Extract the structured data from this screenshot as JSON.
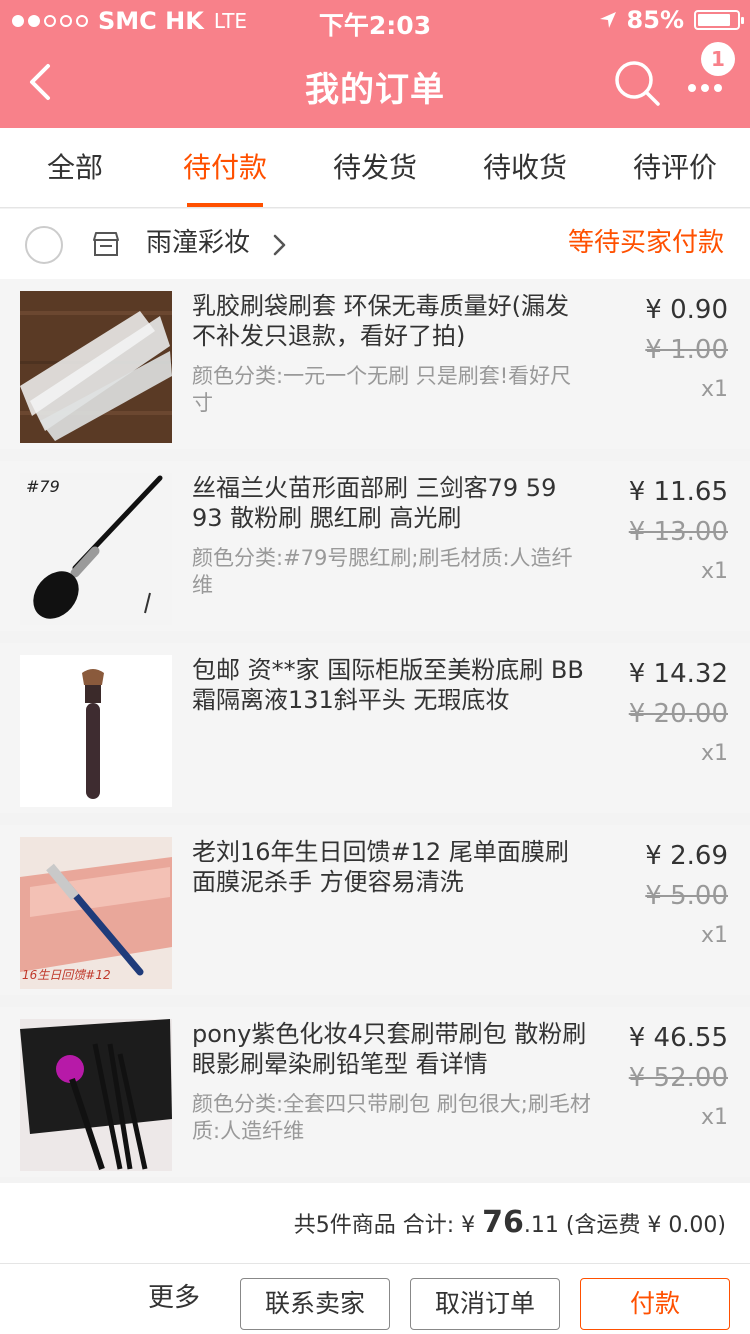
{
  "status_bar": {
    "carrier": "SMC HK",
    "network": "LTE",
    "time": "下午2:03",
    "battery": "85%",
    "battery_level": 0.85
  },
  "nav": {
    "title": "我的订单",
    "badge": "1"
  },
  "tabs": [
    {
      "label": "全部",
      "active": false
    },
    {
      "label": "待付款",
      "active": true
    },
    {
      "label": "待发货",
      "active": false
    },
    {
      "label": "待收货",
      "active": false
    },
    {
      "label": "待评价",
      "active": false
    }
  ],
  "shop": {
    "name": "雨潼彩妆",
    "status": "等待买家付款"
  },
  "items": [
    {
      "name": "乳胶刷袋刷套 环保无毒质量好(漏发不补发只退款，看好了拍)",
      "sku": "颜色分类:一元一个无刷 只是刷套!看好尺寸",
      "price": "¥ 0.90",
      "original_price": "¥ 1.00",
      "qty": "x1"
    },
    {
      "name": "丝福兰火苗形面部刷 三剑客79 59 93 散粉刷 腮红刷 高光刷",
      "sku": "颜色分类:#79号腮红刷;刷毛材质:人造纤维",
      "price": "¥ 11.65",
      "original_price": "¥ 13.00",
      "qty": "x1",
      "photo_label": "#79"
    },
    {
      "name": "包邮 资**家 国际柜版至美粉底刷 BB霜隔离液131斜平头 无瑕底妆",
      "sku": "",
      "price": "¥ 14.32",
      "original_price": "¥ 20.00",
      "qty": "x1"
    },
    {
      "name": "老刘16年生日回馈#12 尾单面膜刷 面膜泥杀手 方便容易清洗",
      "sku": "",
      "price": "¥ 2.69",
      "original_price": "¥ 5.00",
      "qty": "x1",
      "photo_label": "16生日回馈#12"
    },
    {
      "name": "pony紫色化妆4只套刷带刷包  散粉刷眼影刷晕染刷铅笔型 看详情",
      "sku": "颜色分类:全套四只带刷包 刷包很大;刷毛材质:人造纤维",
      "price": "¥ 46.55",
      "original_price": "¥ 52.00",
      "qty": "x1"
    }
  ],
  "summary": {
    "count_text": "共5件商品 合计:",
    "currency": "¥",
    "total_int": "76",
    "total_dec": ".11",
    "shipping": "(含运费 ¥ 0.00)"
  },
  "actions": {
    "more": "更多",
    "contact": "联系卖家",
    "cancel": "取消订单",
    "pay": "付款"
  },
  "colors": {
    "header": "#f8818a",
    "accent": "#ff5000"
  }
}
